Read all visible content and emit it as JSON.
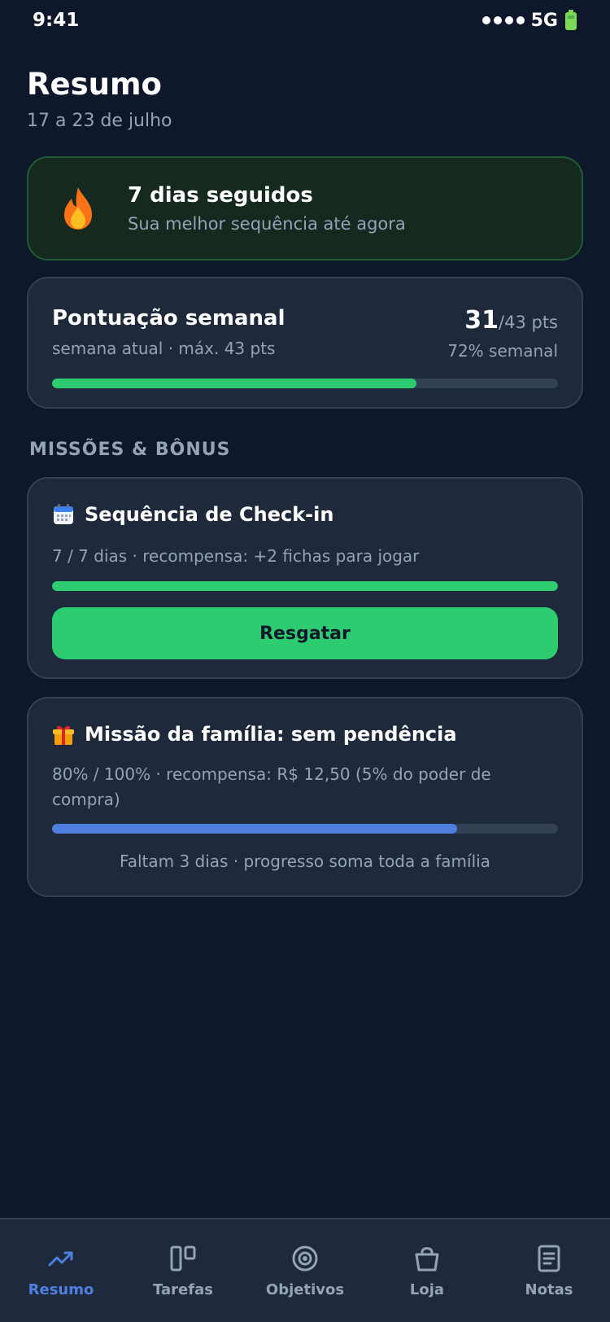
{
  "status_bar": {
    "time": "9:41",
    "network": "5G",
    "signal_icon": "signal-dots-icon",
    "battery_icon": "battery-icon"
  },
  "header": {
    "title": "Resumo",
    "subtitle": "17 a 23 de julho"
  },
  "streak": {
    "icon": "flame-icon",
    "title": "7 dias seguidos",
    "subtitle": "Sua melhor sequência até agora"
  },
  "weekly_score": {
    "title": "Pontuação semanal",
    "subtitle": "semana atual · máx. 43 pts",
    "value": "31",
    "max": "/43 pts",
    "percent_label": "72% semanal",
    "progress": 0.72
  },
  "section": {
    "title": "MISSÕES & BÔNUS"
  },
  "missions": {
    "checkin": {
      "icon": "calendar-icon",
      "title": "Sequência de Check-in",
      "description": "7 / 7 dias · recompensa: +2 fichas para jogar",
      "progress": 1.0,
      "button_label": "Resgatar"
    },
    "family": {
      "icon": "gift-icon",
      "title": "Missão da família: sem pendência",
      "description": "80% / 100% · recompensa: R$ 12,50 (5% do poder de compra)",
      "progress": 0.8,
      "note": "Faltam 3 dias · progresso soma toda a família"
    }
  },
  "nav": {
    "items": [
      {
        "label": "Resumo",
        "icon": "trending-up-icon",
        "active": true
      },
      {
        "label": "Tarefas",
        "icon": "board-icon",
        "active": false
      },
      {
        "label": "Objetivos",
        "icon": "target-icon",
        "active": false
      },
      {
        "label": "Loja",
        "icon": "shopping-bag-icon",
        "active": false
      },
      {
        "label": "Notas",
        "icon": "notes-icon",
        "active": false
      }
    ]
  },
  "colors": {
    "background": "#0f172a",
    "card": "#1e293b",
    "success": "#2ecc71",
    "accent": "#4f7fe0",
    "muted_text": "#94a3b8"
  }
}
